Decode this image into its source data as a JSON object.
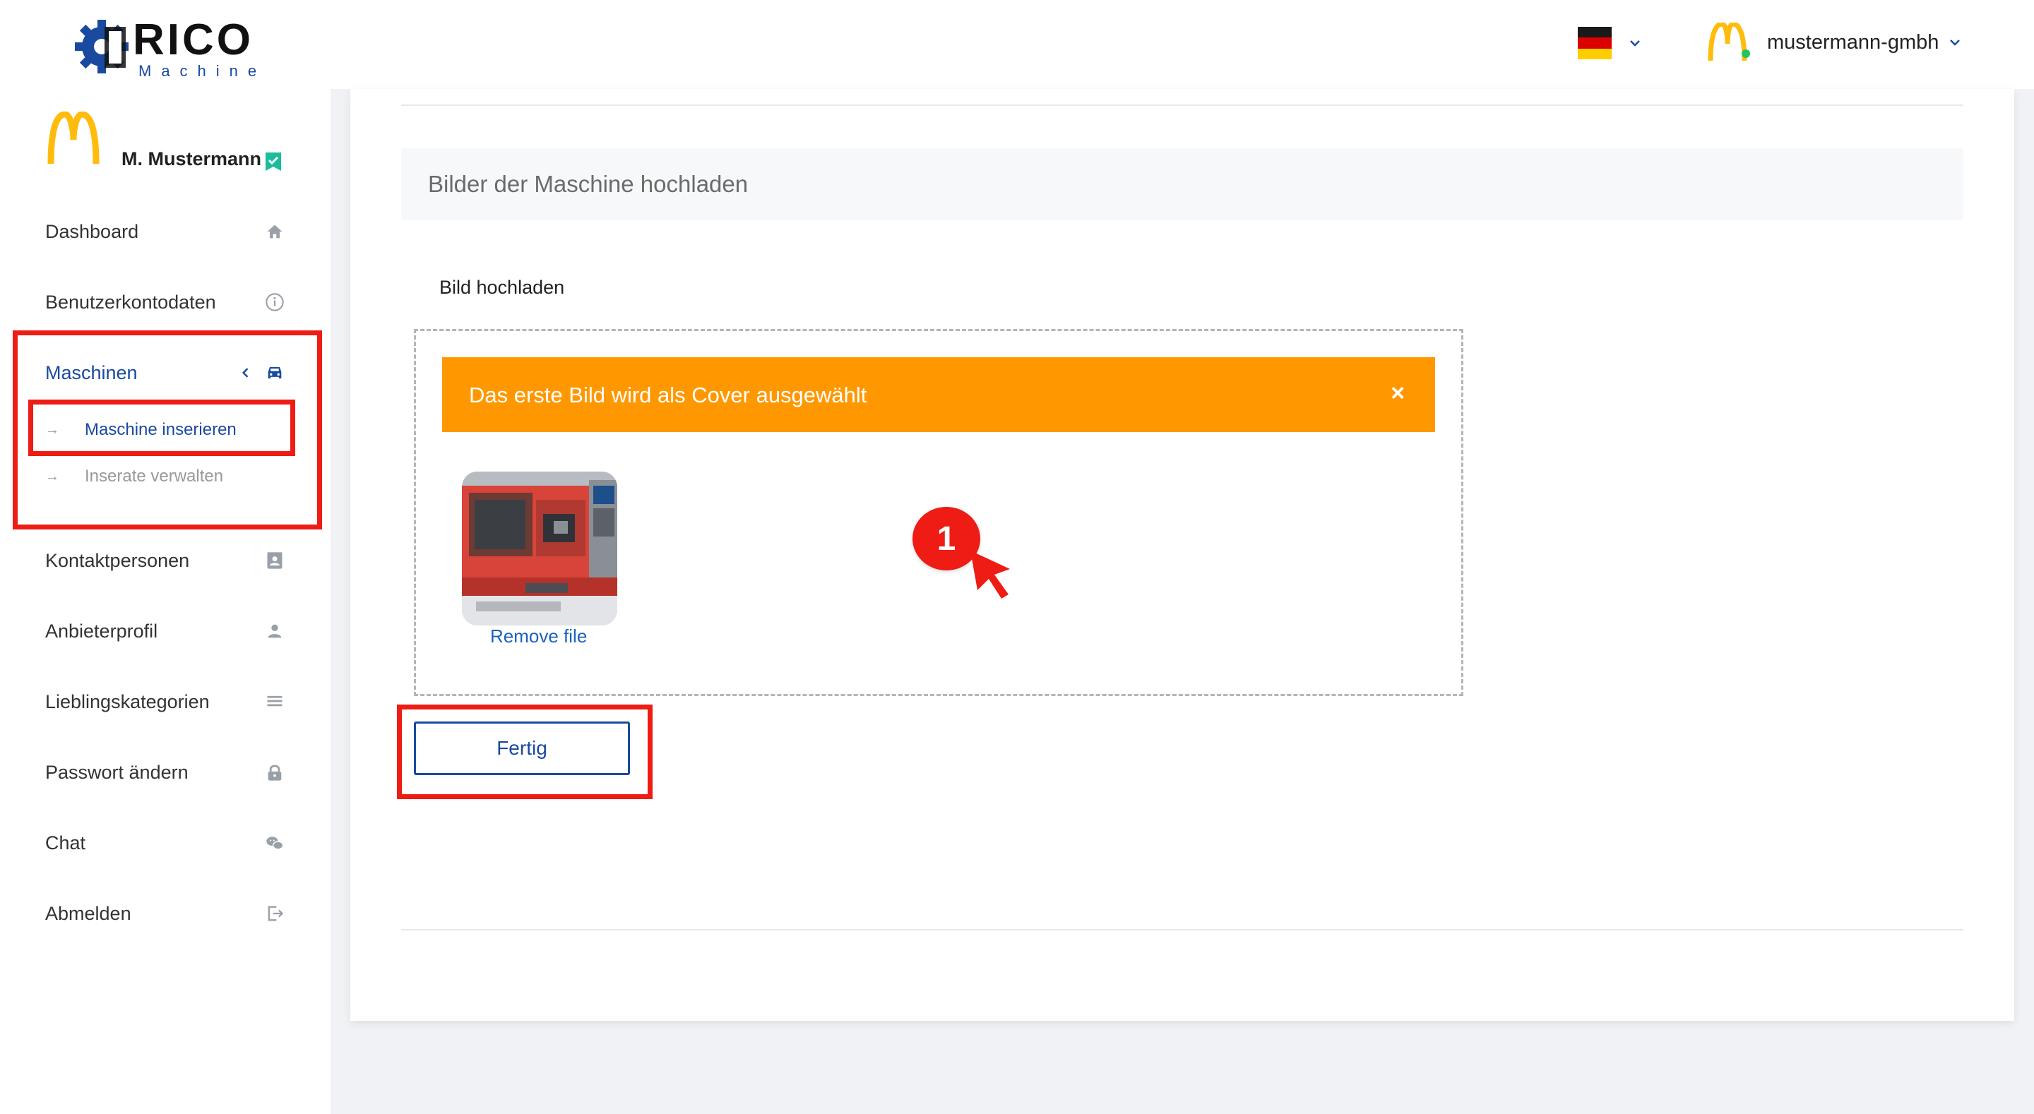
{
  "header": {
    "logo": {
      "brand": "RICO",
      "sub": "Machine"
    },
    "language": {
      "flag": "de-flag",
      "colors": [
        "#1a1a1a",
        "#dd0000",
        "#ffce00"
      ]
    },
    "account": {
      "name": "mustermann-gmbh"
    }
  },
  "sidebar": {
    "profile": {
      "name": "M. Mustermann"
    },
    "items": [
      {
        "label": "Dashboard",
        "icon": "home-icon"
      },
      {
        "label": "Benutzerkontodaten",
        "icon": "info-icon"
      },
      {
        "label": "Maschinen",
        "icon": "car-icon",
        "expanded": true,
        "children": [
          {
            "label": "Maschine inserieren",
            "active": true
          },
          {
            "label": "Inserate verwalten",
            "active": false
          }
        ]
      },
      {
        "label": "Kontaktpersonen",
        "icon": "contact-card-icon"
      },
      {
        "label": "Anbieterprofil",
        "icon": "user-icon"
      },
      {
        "label": "Lieblingskategorien",
        "icon": "list-icon"
      },
      {
        "label": "Passwort ändern",
        "icon": "lock-icon"
      },
      {
        "label": "Chat",
        "icon": "chat-icon"
      },
      {
        "label": "Abmelden",
        "icon": "logout-icon"
      }
    ]
  },
  "main": {
    "section_title": "Bilder der Maschine hochladen",
    "upload_label": "Bild hochladen",
    "alert": {
      "message": "Das erste Bild wird als Cover ausgewählt",
      "close": "×"
    },
    "file": {
      "remove_label": "Remove file"
    },
    "annotation": {
      "step": "1"
    },
    "done_button": "Fertig"
  },
  "colors": {
    "accent_blue": "#1a4aa0",
    "alert_orange": "#ff9800",
    "highlight_red": "#ee1c14",
    "link_blue": "#1a62c0"
  }
}
